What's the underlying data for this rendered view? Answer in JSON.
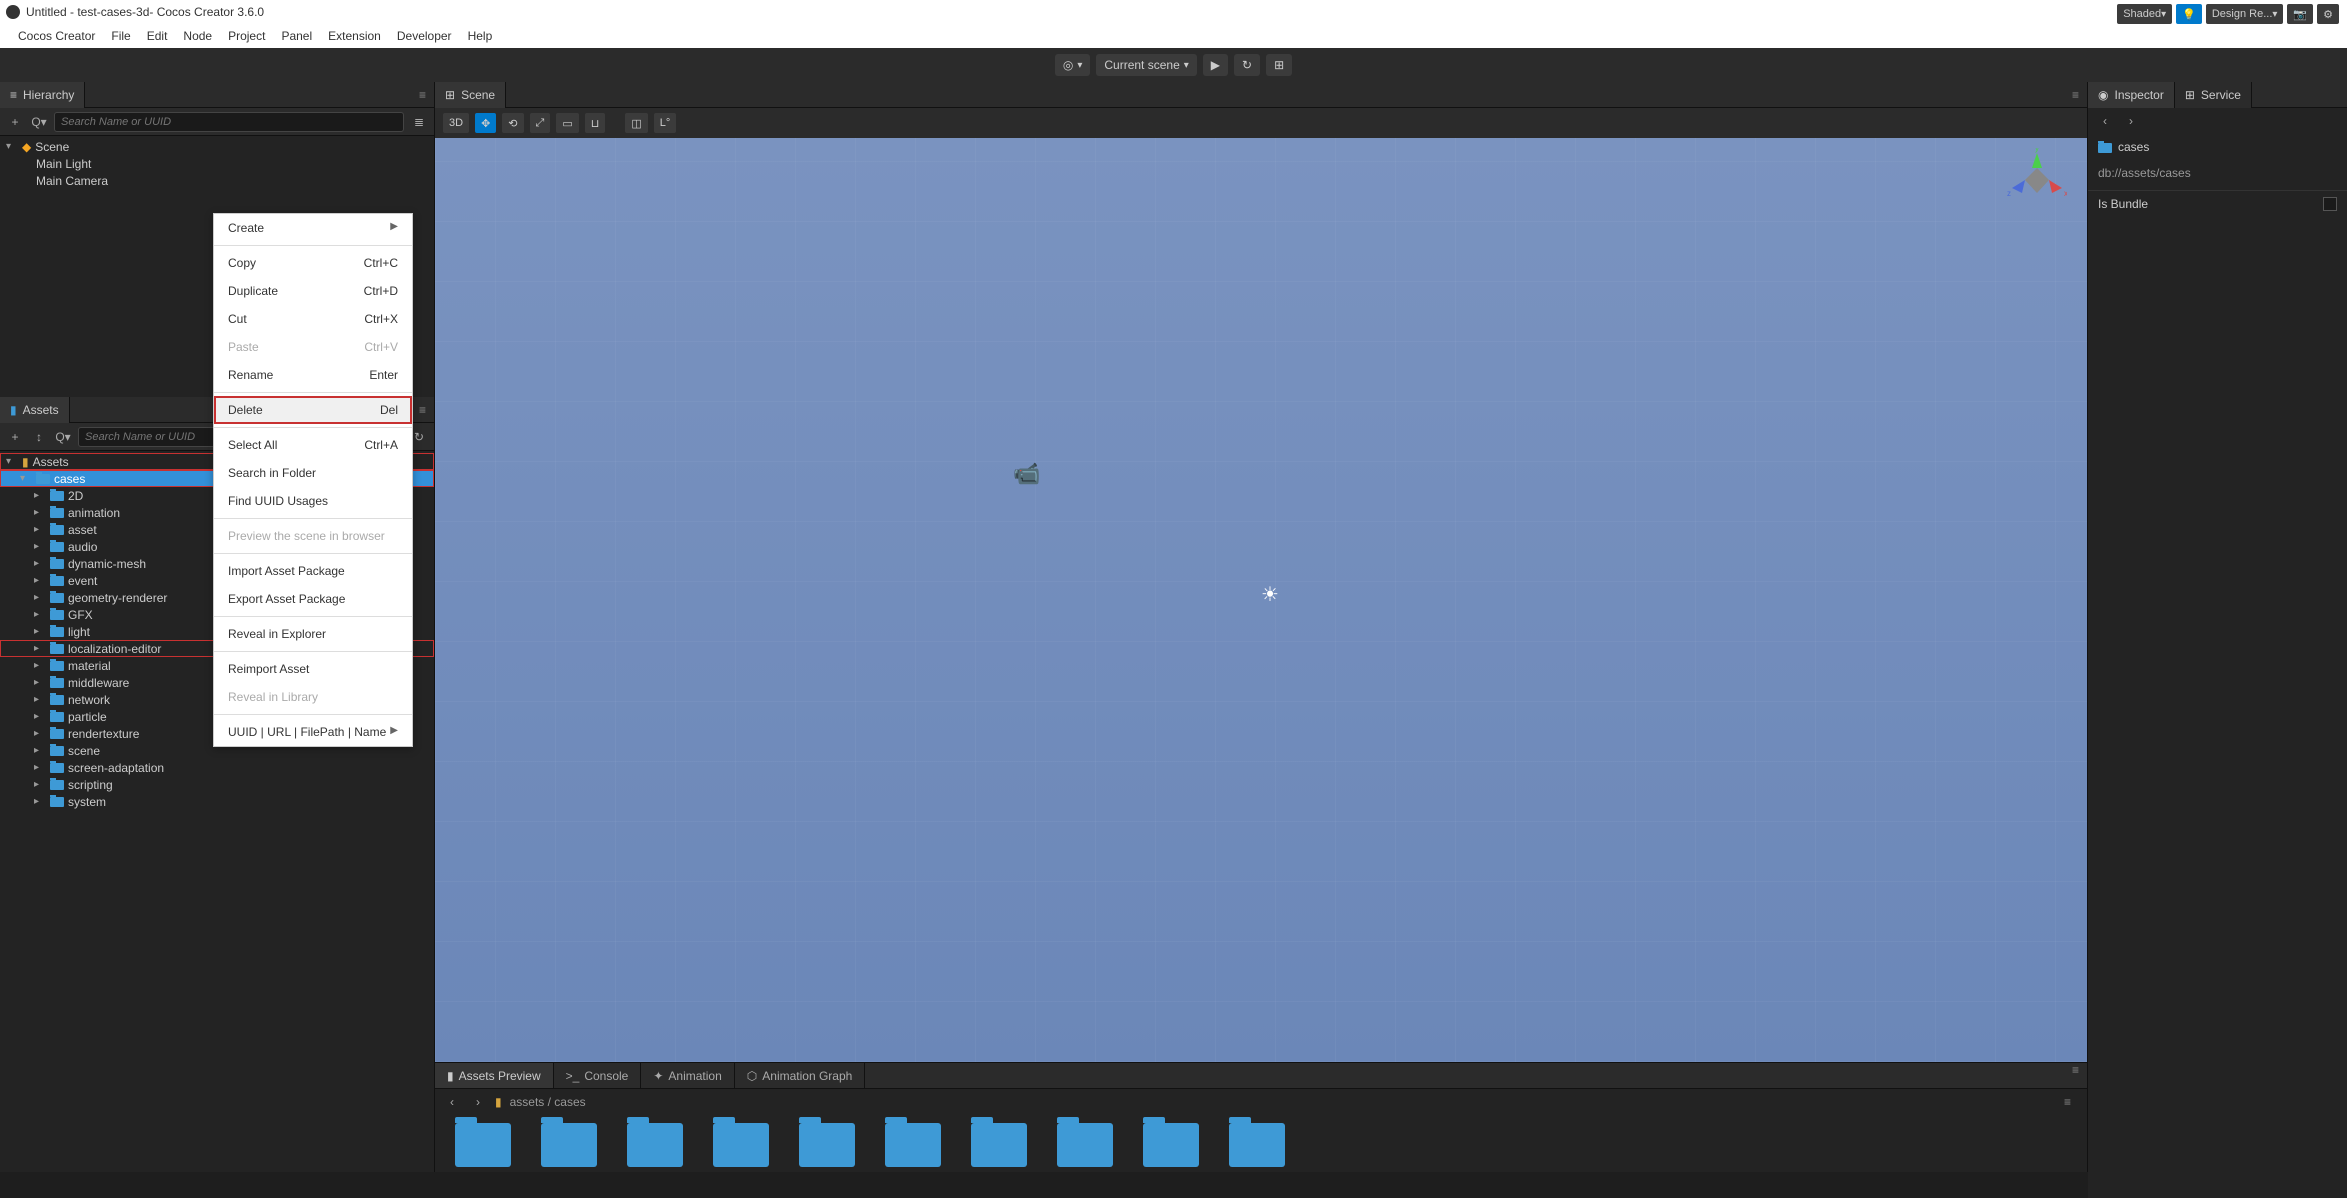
{
  "window": {
    "title": "Untitled - test-cases-3d- Cocos Creator 3.6.0"
  },
  "menubar": [
    "Cocos Creator",
    "File",
    "Edit",
    "Node",
    "Project",
    "Panel",
    "Extension",
    "Developer",
    "Help"
  ],
  "top_toolbar": {
    "scene_label": "Current scene"
  },
  "hierarchy": {
    "title": "Hierarchy",
    "search_placeholder": "Search Name or UUID",
    "items": [
      {
        "name": "Scene",
        "indent": 0,
        "caret": "v",
        "icon": "fire"
      },
      {
        "name": "Main Light",
        "indent": 1
      },
      {
        "name": "Main Camera",
        "indent": 1
      }
    ]
  },
  "assets": {
    "title": "Assets",
    "search_placeholder": "Search Name or UUID",
    "items": [
      {
        "name": "Assets",
        "indent": 0,
        "caret": "v",
        "icon": "db",
        "highlight": true
      },
      {
        "name": "cases",
        "indent": 1,
        "caret": "v",
        "icon": "folder",
        "selected": true,
        "highlight": true
      },
      {
        "name": "2D",
        "indent": 2,
        "caret": ">",
        "icon": "folder"
      },
      {
        "name": "animation",
        "indent": 2,
        "caret": ">",
        "icon": "folder"
      },
      {
        "name": "asset",
        "indent": 2,
        "caret": ">",
        "icon": "folder"
      },
      {
        "name": "audio",
        "indent": 2,
        "caret": ">",
        "icon": "folder"
      },
      {
        "name": "dynamic-mesh",
        "indent": 2,
        "caret": ">",
        "icon": "folder"
      },
      {
        "name": "event",
        "indent": 2,
        "caret": ">",
        "icon": "folder"
      },
      {
        "name": "geometry-renderer",
        "indent": 2,
        "caret": ">",
        "icon": "folder"
      },
      {
        "name": "GFX",
        "indent": 2,
        "caret": ">",
        "icon": "folder"
      },
      {
        "name": "light",
        "indent": 2,
        "caret": ">",
        "icon": "folder"
      },
      {
        "name": "localization-editor",
        "indent": 2,
        "caret": ">",
        "icon": "folder",
        "highlight": true
      },
      {
        "name": "material",
        "indent": 2,
        "caret": ">",
        "icon": "folder"
      },
      {
        "name": "middleware",
        "indent": 2,
        "caret": ">",
        "icon": "folder"
      },
      {
        "name": "network",
        "indent": 2,
        "caret": ">",
        "icon": "folder"
      },
      {
        "name": "particle",
        "indent": 2,
        "caret": ">",
        "icon": "folder"
      },
      {
        "name": "rendertexture",
        "indent": 2,
        "caret": ">",
        "icon": "folder"
      },
      {
        "name": "scene",
        "indent": 2,
        "caret": ">",
        "icon": "folder"
      },
      {
        "name": "screen-adaptation",
        "indent": 2,
        "caret": ">",
        "icon": "folder"
      },
      {
        "name": "scripting",
        "indent": 2,
        "caret": ">",
        "icon": "folder"
      },
      {
        "name": "system",
        "indent": 2,
        "caret": ">",
        "icon": "folder"
      }
    ]
  },
  "context_menu": [
    {
      "label": "Create",
      "arrow": true
    },
    {
      "sep": true
    },
    {
      "label": "Copy",
      "shortcut": "Ctrl+C"
    },
    {
      "label": "Duplicate",
      "shortcut": "Ctrl+D"
    },
    {
      "label": "Cut",
      "shortcut": "Ctrl+X"
    },
    {
      "label": "Paste",
      "shortcut": "Ctrl+V",
      "disabled": true
    },
    {
      "label": "Rename",
      "shortcut": "Enter"
    },
    {
      "sep": true
    },
    {
      "label": "Delete",
      "shortcut": "Del",
      "highlight": true
    },
    {
      "sep": true
    },
    {
      "label": "Select All",
      "shortcut": "Ctrl+A"
    },
    {
      "label": "Search in Folder"
    },
    {
      "label": "Find UUID Usages"
    },
    {
      "sep": true
    },
    {
      "label": "Preview the scene in browser",
      "disabled": true
    },
    {
      "sep": true
    },
    {
      "label": "Import Asset Package"
    },
    {
      "label": "Export Asset Package"
    },
    {
      "sep": true
    },
    {
      "label": "Reveal in Explorer"
    },
    {
      "sep": true
    },
    {
      "label": "Reimport Asset"
    },
    {
      "label": "Reveal in Library",
      "disabled": true
    },
    {
      "sep": true
    },
    {
      "label": "UUID | URL | FilePath | Name",
      "arrow": true
    }
  ],
  "scene": {
    "title": "Scene",
    "mode": "3D",
    "shaded": "Shaded",
    "design": "Design Re..."
  },
  "bottom_tabs": [
    "Assets Preview",
    "Console",
    "Animation",
    "Animation Graph"
  ],
  "crumb": {
    "path": "assets / cases"
  },
  "inspector": {
    "title": "Inspector",
    "service": "Service",
    "folder": "cases",
    "path": "db://assets/cases",
    "bundle_label": "Is Bundle"
  }
}
